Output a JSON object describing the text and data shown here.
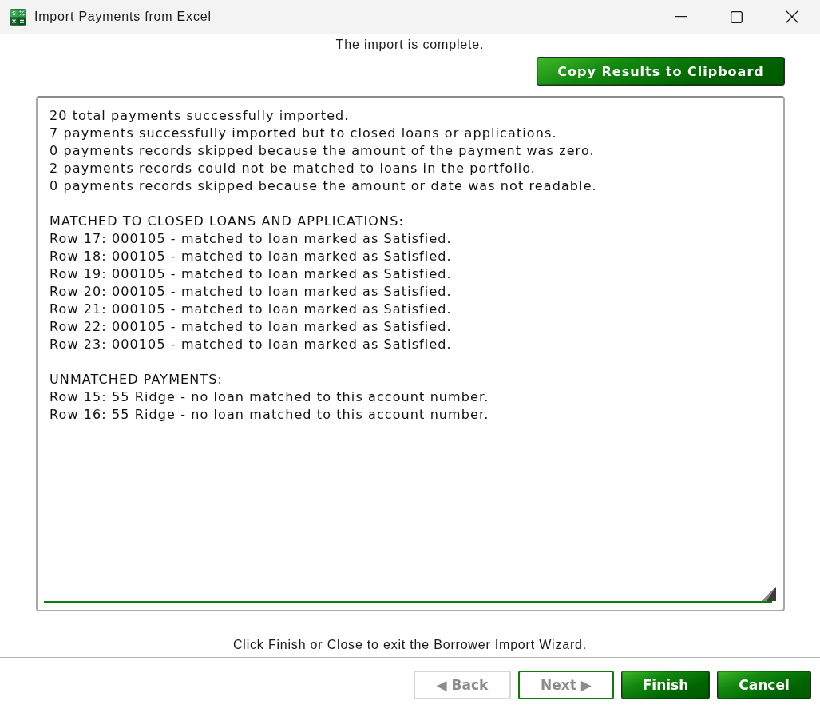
{
  "window": {
    "title": "Import Payments from Excel"
  },
  "status_message": "The import is complete.",
  "copy_button": {
    "label": "Copy Results to Clipboard"
  },
  "results": {
    "focused": true,
    "summary": [
      "20 total payments successfully imported.",
      "7 payments successfully imported but to closed loans or applications.",
      "0 payments records skipped because the amount of the payment was zero.",
      "2 payments records could not be matched to loans in the portfolio.",
      "0 payments records skipped because the amount or date was not readable."
    ],
    "sections": [
      {
        "heading": "MATCHED TO CLOSED LOANS AND APPLICATIONS:",
        "lines": [
          "Row 17: 000105 - matched to loan marked as Satisfied.",
          "Row 18: 000105 - matched to loan marked as Satisfied.",
          "Row 19: 000105 - matched to loan marked as Satisfied.",
          "Row 20: 000105 - matched to loan marked as Satisfied.",
          "Row 21: 000105 - matched to loan marked as Satisfied.",
          "Row 22: 000105 - matched to loan marked as Satisfied.",
          "Row 23: 000105 - matched to loan marked as Satisfied."
        ]
      },
      {
        "heading": "UNMATCHED PAYMENTS:",
        "lines": [
          "Row 15: 55 Ridge - no loan matched to this account number.",
          "Row 16: 55 Ridge - no loan matched to this account number."
        ]
      }
    ]
  },
  "footer_hint": "Click Finish or Close to exit the Borrower Import Wizard.",
  "buttons": [
    {
      "label": "◀ Back",
      "disabled": true,
      "focused": false
    },
    {
      "label": "Next ▶",
      "disabled": true,
      "focused": true
    },
    {
      "label": "Finish",
      "disabled": false,
      "focused": false
    },
    {
      "label": "Cancel",
      "disabled": false,
      "focused": false
    }
  ]
}
